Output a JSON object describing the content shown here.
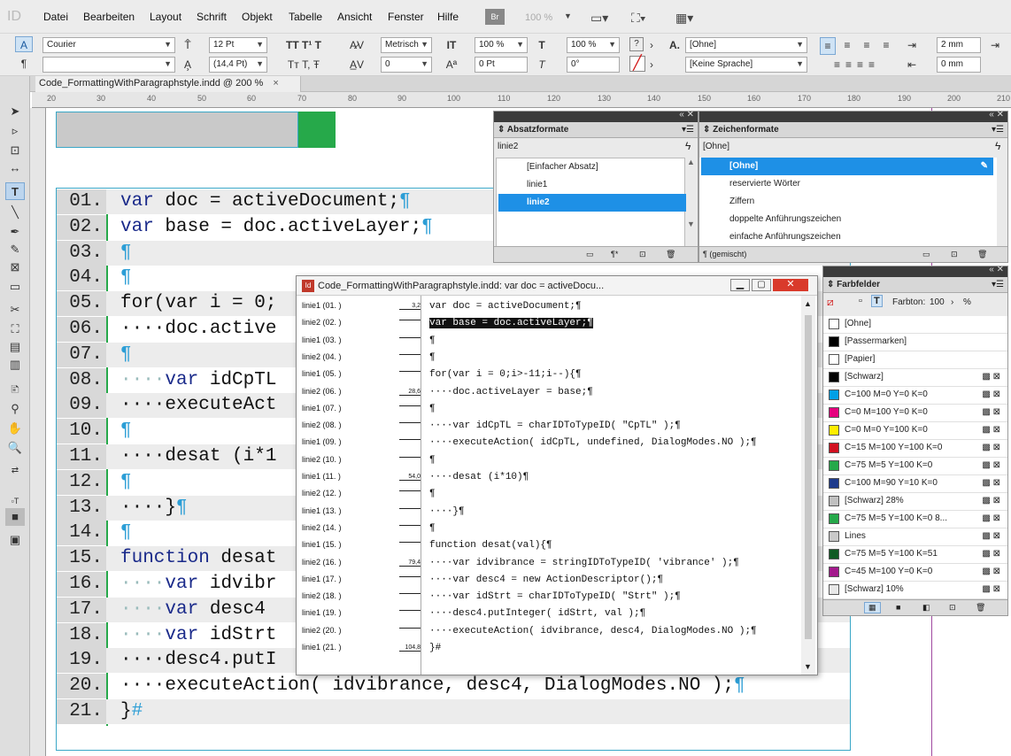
{
  "app": {
    "logo": "ID"
  },
  "menu": [
    "Datei",
    "Bearbeiten",
    "Layout",
    "Schrift",
    "Objekt",
    "Tabelle",
    "Ansicht",
    "Fenster",
    "Hilfe"
  ],
  "menubar": {
    "br": "Br",
    "zoom": "100 %"
  },
  "control": {
    "font_family": "Courier",
    "font_style": "",
    "font_size": "12 Pt",
    "leading": "(14,4 Pt)",
    "kerning": "Metrisch",
    "tracking": "0",
    "vscale": "100 %",
    "hscale": "100 %",
    "baseline": "0 Pt",
    "skew": "0°",
    "char_style": "[Ohne]",
    "language": "[Keine Sprache]",
    "indent_left": "2 mm",
    "indent_right": "0 mm",
    "help": "?"
  },
  "document": {
    "tab_title": "Code_FormattingWithParagraphstyle.indd @ 200 %"
  },
  "ruler": {
    "ticks": [
      "20",
      "30",
      "40",
      "50",
      "60",
      "70",
      "80",
      "90",
      "100",
      "110",
      "120",
      "130",
      "140",
      "150",
      "160",
      "170",
      "180",
      "190",
      "200",
      "210"
    ]
  },
  "code_lines": [
    {
      "n": "01.",
      "kw": "var",
      "rest": " doc = activeDocument;",
      "pil": "¶"
    },
    {
      "n": "02.",
      "kw": "var",
      "rest": " base = doc.activeLayer;",
      "pil": "¶"
    },
    {
      "n": "03.",
      "kw": "",
      "rest": "",
      "pil": "¶"
    },
    {
      "n": "04.",
      "kw": "",
      "rest": "",
      "pil": "¶"
    },
    {
      "n": "05.",
      "kw": "",
      "rest": "for(var i = 0;",
      "pil": ""
    },
    {
      "n": "06.",
      "kw": "",
      "rest": "····doc.active",
      "pil": ""
    },
    {
      "n": "07.",
      "kw": "",
      "rest": "",
      "pil": "¶"
    },
    {
      "n": "08.",
      "kw": "var",
      "rest": " idCpTL",
      "pil": "",
      "indent": "····"
    },
    {
      "n": "09.",
      "kw": "",
      "rest": "····executeAct",
      "pil": ""
    },
    {
      "n": "10.",
      "kw": "",
      "rest": "",
      "pil": "¶"
    },
    {
      "n": "11.",
      "kw": "",
      "rest": "····desat (i*1",
      "pil": ""
    },
    {
      "n": "12.",
      "kw": "",
      "rest": "",
      "pil": "¶"
    },
    {
      "n": "13.",
      "kw": "",
      "rest": "····}",
      "pil": "¶"
    },
    {
      "n": "14.",
      "kw": "",
      "rest": "",
      "pil": "¶"
    },
    {
      "n": "15.",
      "kw": "function",
      "rest": " desat",
      "pil": ""
    },
    {
      "n": "16.",
      "kw": "var",
      "rest": " idvibr",
      "pil": "",
      "indent": "····"
    },
    {
      "n": "17.",
      "kw": "var",
      "rest": " desc4",
      "pil": "",
      "indent": "····"
    },
    {
      "n": "18.",
      "kw": "var",
      "rest": " idStrt",
      "pil": "",
      "indent": "····"
    },
    {
      "n": "19.",
      "kw": "",
      "rest": "····desc4.putI",
      "pil": ""
    },
    {
      "n": "20.",
      "kw": "",
      "rest": "····executeAction( idvibrance, desc4, DialogModes.NO );",
      "pil": "¶"
    },
    {
      "n": "21.",
      "kw": "",
      "rest": "}",
      "pil": "#"
    }
  ],
  "absatz": {
    "title": "Absatzformate",
    "current": "linie2",
    "items": [
      "[Einfacher Absatz]",
      "linie1",
      "linie2"
    ]
  },
  "zeichen": {
    "title": "Zeichenformate",
    "current": "[Ohne]",
    "items": [
      "[Ohne]",
      "reservierte Wörter",
      "Ziffern",
      "doppelte Anführungszeichen",
      "einfache Anführungszeichen"
    ],
    "footer": "¶ (gemischt)"
  },
  "farbfelder": {
    "title": "Farbfelder",
    "tint_label": "Farbton:",
    "tint": "100",
    "pct": "%",
    "items": [
      {
        "name": "[Ohne]",
        "color": "#ffffff"
      },
      {
        "name": "[Passermarken]",
        "color": "#000000"
      },
      {
        "name": "[Papier]",
        "color": "#ffffff"
      },
      {
        "name": "[Schwarz]",
        "color": "#000000"
      },
      {
        "name": "C=100 M=0 Y=0 K=0",
        "color": "#00a0e6"
      },
      {
        "name": "C=0 M=100 Y=0 K=0",
        "color": "#e6007e"
      },
      {
        "name": "C=0 M=0 Y=100 K=0",
        "color": "#ffed00"
      },
      {
        "name": "C=15 M=100 Y=100 K=0",
        "color": "#d11020"
      },
      {
        "name": "C=75 M=5 Y=100 K=0",
        "color": "#26a94a"
      },
      {
        "name": "C=100 M=90 Y=10 K=0",
        "color": "#1d3a8c"
      },
      {
        "name": "[Schwarz] 28%",
        "color": "#c0c0c0"
      },
      {
        "name": "C=75 M=5 Y=100 K=0 8...",
        "color": "#26a94a"
      },
      {
        "name": "Lines",
        "color": "#c9c9c9"
      },
      {
        "name": "C=75 M=5 Y=100 K=51",
        "color": "#0f5a22"
      },
      {
        "name": "C=45 M=100 Y=0 K=0",
        "color": "#a3198c"
      },
      {
        "name": "[Schwarz] 10%",
        "color": "#e8e8e8"
      }
    ]
  },
  "story": {
    "title": "Code_FormattingWithParagraphstyle.indd: var doc = activeDocu...",
    "rows": [
      {
        "style": "linie1 (01. )",
        "depth": "3,2",
        "code": "var doc = activeDocument;¶"
      },
      {
        "style": "linie2 (02. )",
        "depth": "",
        "code": "var base = doc.activeLayer;¶",
        "hl": true
      },
      {
        "style": "linie1 (03. )",
        "depth": "",
        "code": "¶"
      },
      {
        "style": "linie2 (04. )",
        "depth": "",
        "code": "¶"
      },
      {
        "style": "linie1 (05. )",
        "depth": "",
        "code": "for(var i = 0;i>-11;i--){¶"
      },
      {
        "style": "linie2 (06. )",
        "depth": "28,6",
        "code": "····doc.activeLayer = base;¶"
      },
      {
        "style": "linie1 (07. )",
        "depth": "",
        "code": "¶"
      },
      {
        "style": "linie2 (08. )",
        "depth": "",
        "code": "····var idCpTL = charIDToTypeID( \"CpTL\" );¶"
      },
      {
        "style": "linie1 (09. )",
        "depth": "",
        "code": "····executeAction( idCpTL, undefined, DialogModes.NO );¶"
      },
      {
        "style": "linie2 (10. )",
        "depth": "",
        "code": "¶"
      },
      {
        "style": "linie1 (11. )",
        "depth": "54,0",
        "code": "····desat (i*10)¶"
      },
      {
        "style": "linie2 (12. )",
        "depth": "",
        "code": "¶"
      },
      {
        "style": "linie1 (13. )",
        "depth": "",
        "code": "····}¶"
      },
      {
        "style": "linie2 (14. )",
        "depth": "",
        "code": "¶"
      },
      {
        "style": "linie1 (15. )",
        "depth": "",
        "code": "function desat(val){¶"
      },
      {
        "style": "linie2 (16. )",
        "depth": "79,4",
        "code": "····var idvibrance = stringIDToTypeID( 'vibrance' );¶"
      },
      {
        "style": "linie1 (17. )",
        "depth": "",
        "code": "····var desc4 = new ActionDescriptor();¶"
      },
      {
        "style": "linie2 (18. )",
        "depth": "",
        "code": "····var idStrt = charIDToTypeID( \"Strt\" );¶"
      },
      {
        "style": "linie1 (19. )",
        "depth": "",
        "code": "····desc4.putInteger( idStrt, val );¶"
      },
      {
        "style": "linie2 (20. )",
        "depth": "",
        "code": "····executeAction( idvibrance, desc4, DialogModes.NO );¶"
      },
      {
        "style": "linie1 (21. )",
        "depth": "104,8",
        "code": "}#"
      }
    ]
  }
}
